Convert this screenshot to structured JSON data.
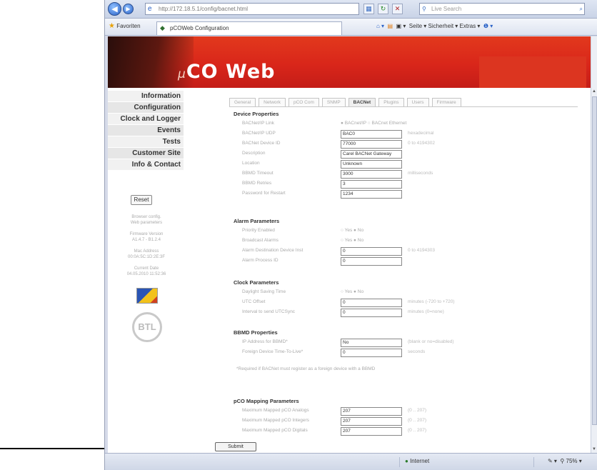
{
  "browser": {
    "address": "http://172.18.5.1/config/bacnet.html",
    "search_placeholder": "Live Search",
    "favorites_label": "Favoriten",
    "tab_title": "pCOWeb Configuration",
    "command_bar": "Seite ▾   Sicherheit ▾   Extras ▾",
    "status_zone": "Internet",
    "zoom": "75%"
  },
  "banner": {
    "logo_prefix": "μ",
    "logo_text": "CO Web"
  },
  "sidebar": {
    "items": [
      {
        "label": "Information"
      },
      {
        "label": "Configuration"
      },
      {
        "label": "Clock and Logger"
      },
      {
        "label": "Events"
      },
      {
        "label": "Tests"
      },
      {
        "label": "Customer Site"
      },
      {
        "label": "Info & Contact"
      }
    ],
    "reset_label": "Reset",
    "info_lines": [
      "Browser config.",
      "Web parameters",
      "Firmware Version",
      "A1.4.7 - B1.2.4",
      "Mac Address",
      "00:0A:5C:1D:2E:3F",
      "Current Date",
      "04.05.2010 11:52:36"
    ]
  },
  "tabs": [
    {
      "label": "General"
    },
    {
      "label": "Network"
    },
    {
      "label": "pCO Com"
    },
    {
      "label": "SNMP"
    },
    {
      "label": "BACNet"
    },
    {
      "label": "Plugins"
    },
    {
      "label": "Users"
    },
    {
      "label": "Firmware"
    }
  ],
  "device": {
    "title": "Device Properties",
    "rows": [
      {
        "label": "BACNet/IP Link",
        "type": "radio",
        "value": "● BACnet/IP  ○ BACnet Ethernet"
      },
      {
        "label": "BACNet/IP UDP",
        "type": "field",
        "value": "BAC0",
        "hint": "hexadecimal"
      },
      {
        "label": "BACNet Device ID",
        "type": "field",
        "value": "77000",
        "hint": "0 to 4194302"
      },
      {
        "label": "Description",
        "type": "field",
        "value": "Carel BACNet Gateway"
      },
      {
        "label": "Location",
        "type": "field",
        "value": "Unknown"
      },
      {
        "label": "BBMD Timeout",
        "type": "field",
        "value": "3000",
        "hint": "milliseconds"
      },
      {
        "label": "BBMD Retries",
        "type": "field",
        "value": "3"
      },
      {
        "label": "Password for Restart",
        "type": "field",
        "value": "1234"
      }
    ]
  },
  "alarm": {
    "title": "Alarm Parameters",
    "rows": [
      {
        "label": "Priority Enabled",
        "type": "radio",
        "value": "○ Yes  ● No"
      },
      {
        "label": "Broadcast Alarms",
        "type": "radio",
        "value": "○ Yes  ● No"
      },
      {
        "label": "Alarm Destination Device Inst",
        "type": "field",
        "value": "0",
        "hint": "0 to 4194303"
      },
      {
        "label": "Alarm Process ID",
        "type": "field",
        "value": "0"
      }
    ]
  },
  "clock": {
    "title": "Clock Parameters",
    "rows": [
      {
        "label": "Daylight Saving Time",
        "type": "radio",
        "value": "○ Yes  ● No"
      },
      {
        "label": "UTC Offset",
        "type": "field",
        "value": "0",
        "hint": "minutes (-720 to +720)"
      },
      {
        "label": "Interval to send UTCSync",
        "type": "field",
        "value": "0",
        "hint": "minutes (0=none)"
      }
    ]
  },
  "bbmd": {
    "title": "BBMD Properties",
    "rows": [
      {
        "label": "IP Address for BBMD*",
        "type": "field",
        "value": "No",
        "hint": "(blank or no=disabled)"
      },
      {
        "label": "Foreign Device Time-To-Live*",
        "type": "field",
        "value": "0",
        "hint": "seconds"
      }
    ],
    "note": "*Required if BACNet must register as a foreign device with a BBMD"
  },
  "pco": {
    "title": "pCO Mapping Parameters",
    "rows": [
      {
        "label": "Maximum Mapped pCO Analogs",
        "type": "field",
        "value": "207",
        "hint": "(0 .. 207)"
      },
      {
        "label": "Maximum Mapped pCO Integers",
        "type": "field",
        "value": "207",
        "hint": "(0 .. 207)"
      },
      {
        "label": "Maximum Mapped pCO Digitals",
        "type": "field",
        "value": "207",
        "hint": "(0 .. 207)"
      }
    ]
  },
  "submit_label": "Submit"
}
